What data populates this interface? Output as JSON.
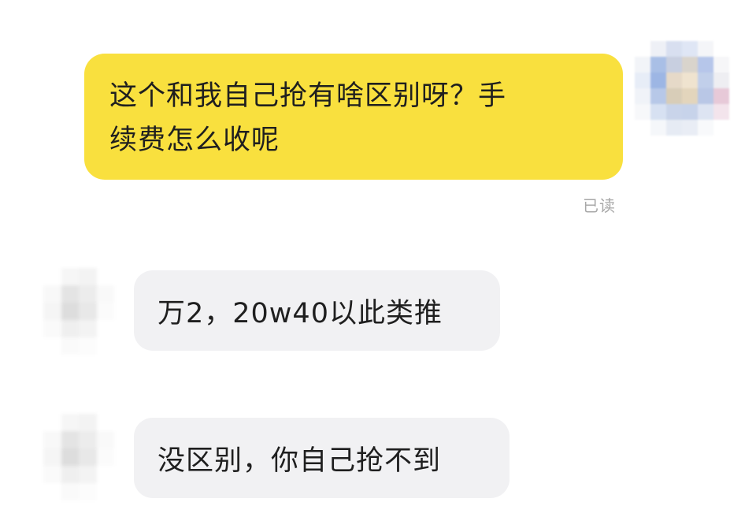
{
  "messages": [
    {
      "sender": "self",
      "text": "这个和我自己抢有啥区别呀？手\n续费怎么收呢",
      "status": "已读"
    },
    {
      "sender": "other",
      "text": "万2，20w40以此类推"
    },
    {
      "sender": "other",
      "text": "没区别，你自己抢不到"
    }
  ],
  "colors": {
    "outgoing_bubble": "#f9e03e",
    "incoming_bubble": "#f1f1f3",
    "read_receipt": "#a8a8a8",
    "background": "#ffffff"
  },
  "icons": {
    "self_avatar": "avatar-icon",
    "other_avatar": "avatar-icon"
  }
}
